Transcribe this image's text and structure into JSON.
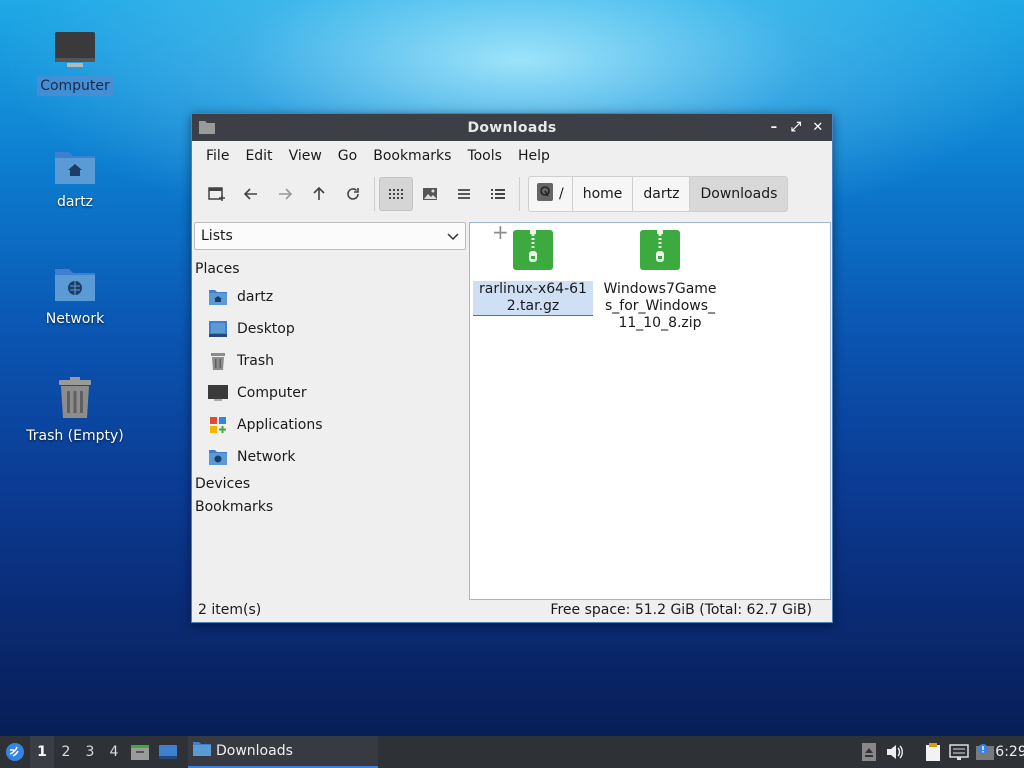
{
  "desktop": {
    "icons": [
      {
        "label": "Computer"
      },
      {
        "label": "dartz"
      },
      {
        "label": "Network"
      },
      {
        "label": "Trash (Empty)"
      }
    ]
  },
  "window": {
    "title": "Downloads",
    "menu": [
      "File",
      "Edit",
      "View",
      "Go",
      "Bookmarks",
      "Tools",
      "Help"
    ],
    "path": [
      "/",
      "home",
      "dartz",
      "Downloads"
    ],
    "side_view": "Lists",
    "sections": {
      "places": "Places",
      "devices": "Devices",
      "bookmarks": "Bookmarks"
    },
    "places": [
      "dartz",
      "Desktop",
      "Trash",
      "Computer",
      "Applications",
      "Network"
    ],
    "files": [
      {
        "name": "rarlinux-x64-612.tar.gz"
      },
      {
        "name": "Windows7Games_for_Windows_11_10_8.zip"
      }
    ],
    "status": {
      "count": "2 item(s)",
      "space": "Free space: 51.2 GiB (Total: 62.7 GiB)"
    }
  },
  "taskbar": {
    "workspaces": [
      "1",
      "2",
      "3",
      "4"
    ],
    "active_task": "Downloads",
    "clock": "6:29"
  },
  "colors": {
    "accent": "#3584e4",
    "archive_green": "#3daa3f",
    "folder_blue": "#5b9bd5"
  }
}
